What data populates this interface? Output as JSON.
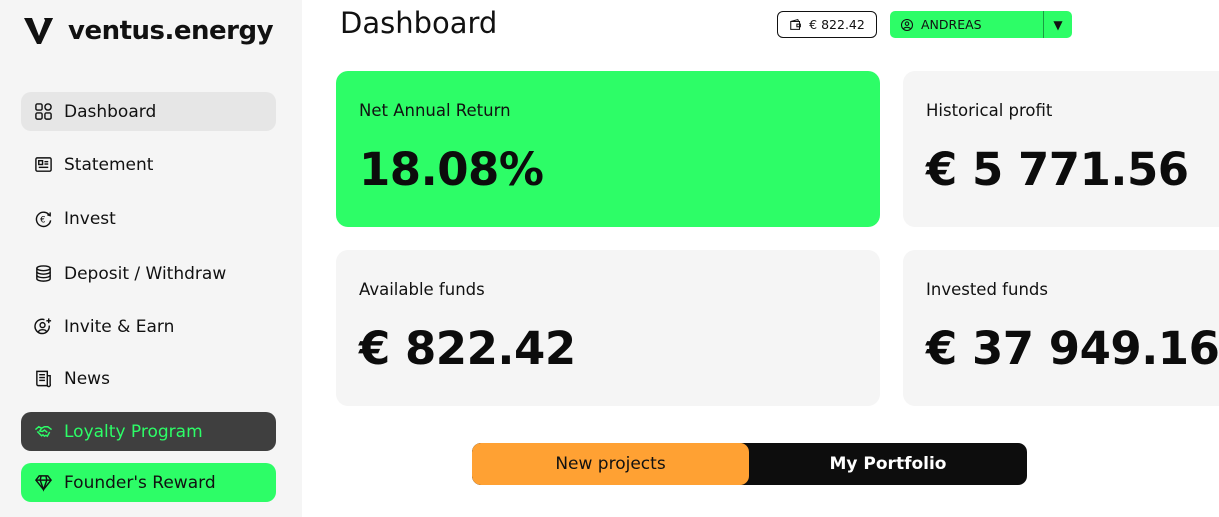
{
  "brand": {
    "name": "ventus.energy"
  },
  "sidebar": {
    "items": [
      {
        "label": "Dashboard",
        "icon": "grid-icon"
      },
      {
        "label": "Statement",
        "icon": "statement-icon"
      },
      {
        "label": "Invest",
        "icon": "euro-cycle-icon"
      },
      {
        "label": "Deposit / Withdraw",
        "icon": "database-icon"
      },
      {
        "label": "Invite & Earn",
        "icon": "user-plus-icon"
      },
      {
        "label": "News",
        "icon": "news-icon"
      },
      {
        "label": "Loyalty Program",
        "icon": "handshake-icon"
      },
      {
        "label": "Founder's Reward",
        "icon": "diamond-icon"
      }
    ]
  },
  "header": {
    "title": "Dashboard",
    "balance": "€ 822.42",
    "user": "ANDREAS"
  },
  "cards": {
    "net_return": {
      "label": "Net Annual Return",
      "value": "18.08%"
    },
    "historical_profit": {
      "label": "Historical profit",
      "value": "€ 5 771.56"
    },
    "available_funds": {
      "label": "Available funds",
      "value": "€ 822.42"
    },
    "invested_funds": {
      "label": "Invested funds",
      "value": "€ 37 949.16"
    }
  },
  "tabs": {
    "new_projects": "New projects",
    "my_portfolio": "My Portfolio"
  },
  "colors": {
    "accent_green": "#2dfd67",
    "accent_orange": "#ffa133",
    "dark": "#0d0d0d",
    "sidebar_bg": "#f5f5f5",
    "card_bg": "#f5f5f5"
  }
}
